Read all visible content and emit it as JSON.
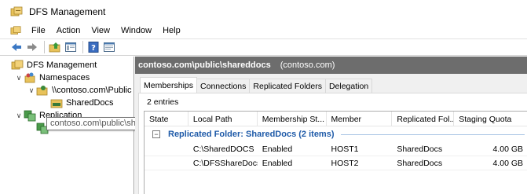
{
  "window": {
    "title": "DFS Management",
    "icon": "dfs-management-icon"
  },
  "menu": {
    "items": [
      "File",
      "Action",
      "View",
      "Window",
      "Help"
    ]
  },
  "toolbar": {
    "buttons": [
      "back-icon",
      "forward-icon",
      "up-folder-icon",
      "show-hide-tree-icon",
      "help-icon",
      "properties-icon"
    ]
  },
  "tree": {
    "root": "DFS Management",
    "namespaces": "Namespaces",
    "namespace_path": "\\\\contoso.com\\Public",
    "shared_docs": "SharedDocs",
    "replication": "Replication",
    "tooltip": "contoso.com\\public\\shareddocs"
  },
  "header": {
    "path": "contoso.com\\public\\shareddocs",
    "domain": "(contoso.com)"
  },
  "tabs": [
    "Memberships",
    "Connections",
    "Replicated Folders",
    "Delegation"
  ],
  "active_tab": "Memberships",
  "entries": "2 entries",
  "columns": [
    "State",
    "Local Path",
    "Membership St...",
    "Member",
    "Replicated Fol...",
    "Staging Quota"
  ],
  "group": {
    "title": "Replicated Folder: SharedDocs (2 items)",
    "toggle": "−"
  },
  "rows": [
    {
      "state": "",
      "local_path": "C:\\SharedDOCS",
      "membership": "Enabled",
      "member": "HOST1",
      "replicated_folder": "SharedDocs",
      "quota": "4.00 GB"
    },
    {
      "state": "",
      "local_path": "C:\\DFSShareDocs",
      "membership": "Enabled",
      "member": "HOST2",
      "replicated_folder": "SharedDocs",
      "quota": "4.00 GB"
    }
  ]
}
